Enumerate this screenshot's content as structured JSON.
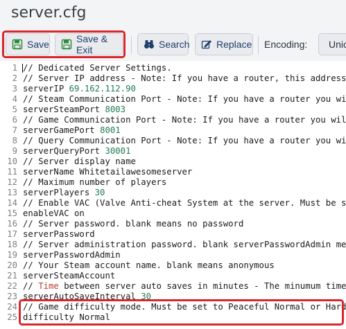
{
  "window": {
    "title": "server.cfg"
  },
  "toolbar": {
    "save_label": "Save",
    "save_exit_label": "Save & Exit",
    "search_label": "Search",
    "replace_label": "Replace",
    "encoding_label": "Encoding:",
    "encoding_value": "Unic"
  },
  "editor": {
    "lines": [
      {
        "n": "1",
        "t": "// Dedicated Server Settings."
      },
      {
        "n": "2",
        "t": "// Server IP address - Note: If you have a router, this address i"
      },
      {
        "n": "3",
        "t": "serverIP ",
        "v": "69.162.112.90"
      },
      {
        "n": "4",
        "t": "// Steam Communication Port - Note: If you have a router you will"
      },
      {
        "n": "5",
        "t": "serverSteamPort ",
        "v": "8003"
      },
      {
        "n": "6",
        "t": "// Game Communication Port - Note: If you have a router you will ("
      },
      {
        "n": "7",
        "t": "serverGamePort ",
        "v": "8001"
      },
      {
        "n": "8",
        "t": "// Query Communication Port - Note: If you have a router you will"
      },
      {
        "n": "9",
        "t": "serverQueryPort ",
        "v": "30001"
      },
      {
        "n": "10",
        "t": "// Server display name"
      },
      {
        "n": "11",
        "t": "serverName Whitetailawesomeserver"
      },
      {
        "n": "12",
        "t": "// Maximum number of players"
      },
      {
        "n": "13",
        "t": "serverPlayers ",
        "v": "30"
      },
      {
        "n": "14",
        "t": "// Enable VAC (Valve Anti-cheat System at the server. Must be set"
      },
      {
        "n": "15",
        "t": "enableVAC on"
      },
      {
        "n": "16",
        "t": "// Server password. blank means no password"
      },
      {
        "n": "17",
        "t": "serverPassword"
      },
      {
        "n": "18",
        "t": "// Server administration password. blank serverPasswordAdmin mean"
      },
      {
        "n": "19",
        "t": "serverPasswordAdmin"
      },
      {
        "n": "20",
        "t": "// Your Steam account name. blank means anonymous"
      },
      {
        "n": "21",
        "t": "serverSteamAccount"
      },
      {
        "n": "22",
        "t": "// ",
        "k": "Time",
        "r": " between server auto saves in minutes - The minumum time i"
      },
      {
        "n": "23",
        "t": "serverAutoSaveInterval ",
        "v": "30"
      },
      {
        "n": "24",
        "t": "// Game difficulty mode. Must be set to Peaceful Normal or Hard"
      },
      {
        "n": "25",
        "t": "difficulty Normal"
      }
    ]
  },
  "colors": {
    "highlight": "#d9262c",
    "toolbar_text": "#1f3f6a",
    "number": "#1f7a52",
    "keyword": "#c0392b"
  }
}
